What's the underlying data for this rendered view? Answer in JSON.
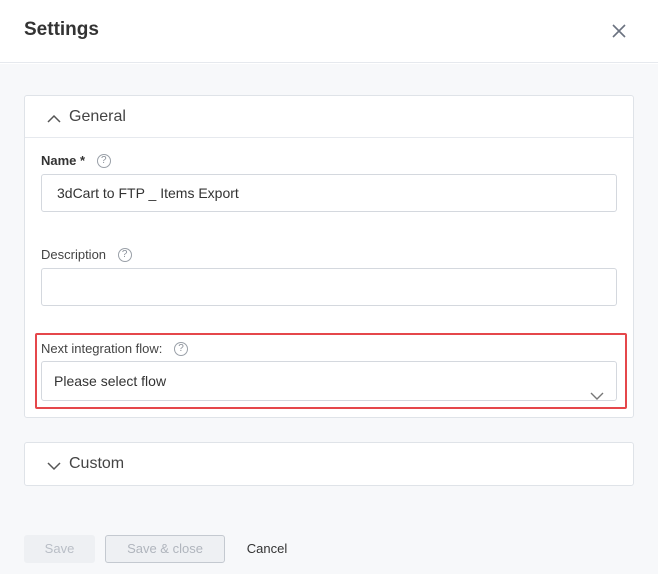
{
  "dialog": {
    "title": "Settings",
    "close_icon": "close-icon"
  },
  "general": {
    "title": "General",
    "icon": "chevron-up-icon",
    "name_label": "Name",
    "name_required": "*",
    "name_value": "3dCart to FTP _ Items Export",
    "description_label": "Description",
    "description_value": "",
    "next_flow_label": "Next integration flow:",
    "next_flow_value": "Please select flow",
    "help_glyph": "?",
    "highlight_color": "#e5474b"
  },
  "custom": {
    "title": "Custom",
    "icon": "chevron-down-icon"
  },
  "footer": {
    "save_label": "Save",
    "save_close_label": "Save & close",
    "cancel_label": "Cancel"
  }
}
